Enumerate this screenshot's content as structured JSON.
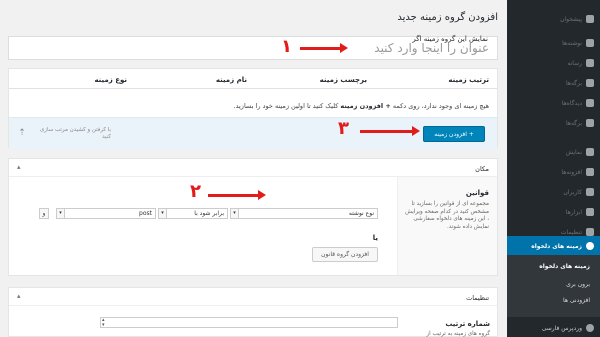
{
  "sidebar": {
    "items": [
      {
        "label": "پیشخوان"
      },
      {
        "label": "نوشته‌ها"
      },
      {
        "label": "رسانه"
      },
      {
        "label": "برگه‌ها"
      },
      {
        "label": "دیدگاه‌ها"
      },
      {
        "label": "برگه‌ها"
      },
      {
        "label": "نمایش"
      },
      {
        "label": "افزونه‌ها"
      },
      {
        "label": "کاربران"
      },
      {
        "label": "ابزارها"
      },
      {
        "label": "تنظیمات"
      }
    ],
    "active": {
      "label": "زمینه های دلخواه"
    },
    "submenu": [
      "زمینه های دلخواه",
      "برون بری",
      "افزودنی ها"
    ],
    "bottom": {
      "label": "وردپرس فارسی"
    }
  },
  "page": {
    "title": "افزودن گروه زمینه جدید",
    "title_placeholder": "عنوان را اینجا وارد کنید"
  },
  "fields": {
    "columns": [
      "ترتیب زمینه",
      "برچسب زمینه",
      "نام زمینه",
      "نوع زمینه"
    ],
    "empty_before": "هیچ زمینه ای وجود ندارد، روی دکمه",
    "empty_bold": "+ افزودن زمینه",
    "empty_after": " کلیک کنید تا اولین زمینه خود را بسازید.",
    "add_button": "+ افزودن زمینه",
    "drag_hint": "با کرفتن و کشیدن مرتب سازی کنید",
    "drag_icon": "arrow-up-icon"
  },
  "location": {
    "title": "مکان",
    "rules_label": "قوانین",
    "rules_desc": "مجموعه ای از قوانین را بسازید تا مشخص کنید در کدام صفحه ویرایش ، این زمینه های دلخواه سفارشی نمایش داده شوند.",
    "rule_heading": "نمایش این گروه زمینه اگر",
    "param_value": "نوع نوشته",
    "operator_value": "برابر شود با",
    "value_value": "post",
    "and_label": "و",
    "or_label": "یا",
    "add_group_button": "افزودن گروه قانون"
  },
  "settings": {
    "title": "تنظیمات",
    "order_label": "شماره ترتیب",
    "order_desc": "گروه های زمینه به ترتیب از"
  },
  "annotations": {
    "one": "۱",
    "two": "۲",
    "three": "۳",
    "color": "#e21b1b"
  }
}
